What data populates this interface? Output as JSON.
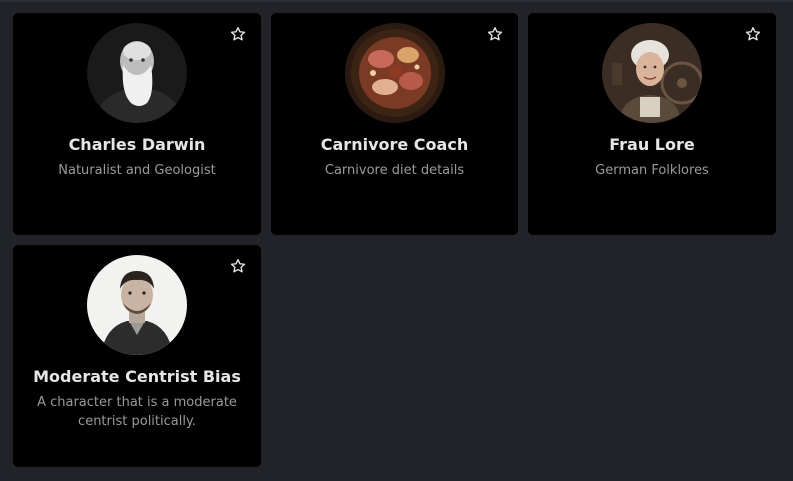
{
  "cards": [
    {
      "name": "Charles Darwin",
      "description": "Naturalist and Geologist",
      "avatar": "charles-darwin-portrait",
      "favorite_icon": "star-outline-icon"
    },
    {
      "name": "Carnivore Coach",
      "description": "Carnivore diet details",
      "avatar": "meat-platter-image",
      "favorite_icon": "star-outline-icon"
    },
    {
      "name": "Frau Lore",
      "description": "German Folklores",
      "avatar": "elderly-woman-portrait",
      "favorite_icon": "star-outline-icon"
    },
    {
      "name": "Moderate Centrist Bias",
      "description": "A character that is a moderate centrist politically.",
      "avatar": "man-portrait-sketch",
      "favorite_icon": "star-outline-icon"
    }
  ],
  "colors": {
    "page_background": "#212328",
    "card_background": "#000000",
    "name_text": "#e6e6e6",
    "description_text": "#9a9a9a"
  }
}
